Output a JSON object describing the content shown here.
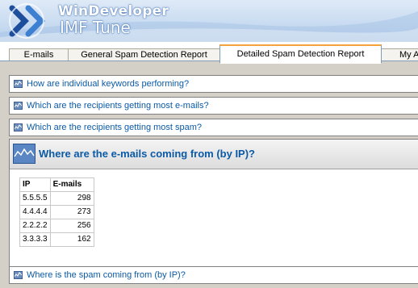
{
  "header": {
    "brand": "WinDeveloper",
    "product": "IMF Tune"
  },
  "tabs": [
    {
      "label": "E-mails",
      "active": false
    },
    {
      "label": "General Spam Detection Report",
      "active": false
    },
    {
      "label": "Detailed Spam Detection Report",
      "active": true
    },
    {
      "label": "My A",
      "active": false
    }
  ],
  "panels": {
    "keywords": "How are individual keywords performing?",
    "recipients_email": "Which are the recipients getting most e-mails?",
    "recipients_spam": "Which are the recipients getting most spam?",
    "emails_by_ip": "Where are the e-mails coming from (by IP)?",
    "spam_by_ip": "Where is the spam coming from (by IP)?"
  },
  "ip_table": {
    "columns": [
      "IP",
      "E-mails"
    ],
    "rows": [
      {
        "ip": "5.5.5.5",
        "emails": "298"
      },
      {
        "ip": "4.4.4.4",
        "emails": "273"
      },
      {
        "ip": "2.2.2.2",
        "emails": "256"
      },
      {
        "ip": "3.3.3.3",
        "emails": "162"
      }
    ]
  },
  "colors": {
    "link_blue": "#0b5aa6",
    "tab_accent": "#f3a33c",
    "content_bg": "#d4d0c8"
  },
  "icons": {
    "logo": "windeveloper-logo-icon",
    "panel": "report-graph-icon"
  }
}
